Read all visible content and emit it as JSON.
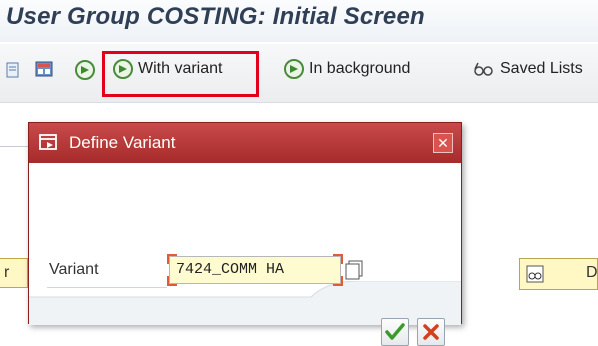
{
  "window": {
    "title": "User Group COSTING: Initial Screen"
  },
  "toolbar": {
    "with_variant": "With variant",
    "in_background": "In background",
    "saved_lists": "Saved Lists"
  },
  "background": {
    "left_field_text": "r",
    "right_field_text": "D"
  },
  "dialog": {
    "title": "Define Variant",
    "variant_label": "Variant",
    "variant_value": "7424_COMM HA"
  },
  "colors": {
    "highlight": "#e3001b",
    "dialog_header": "#b23535",
    "input_bg": "#fffbd0",
    "confirm_green": "#3c9a2d",
    "cancel_red": "#d3401f"
  }
}
